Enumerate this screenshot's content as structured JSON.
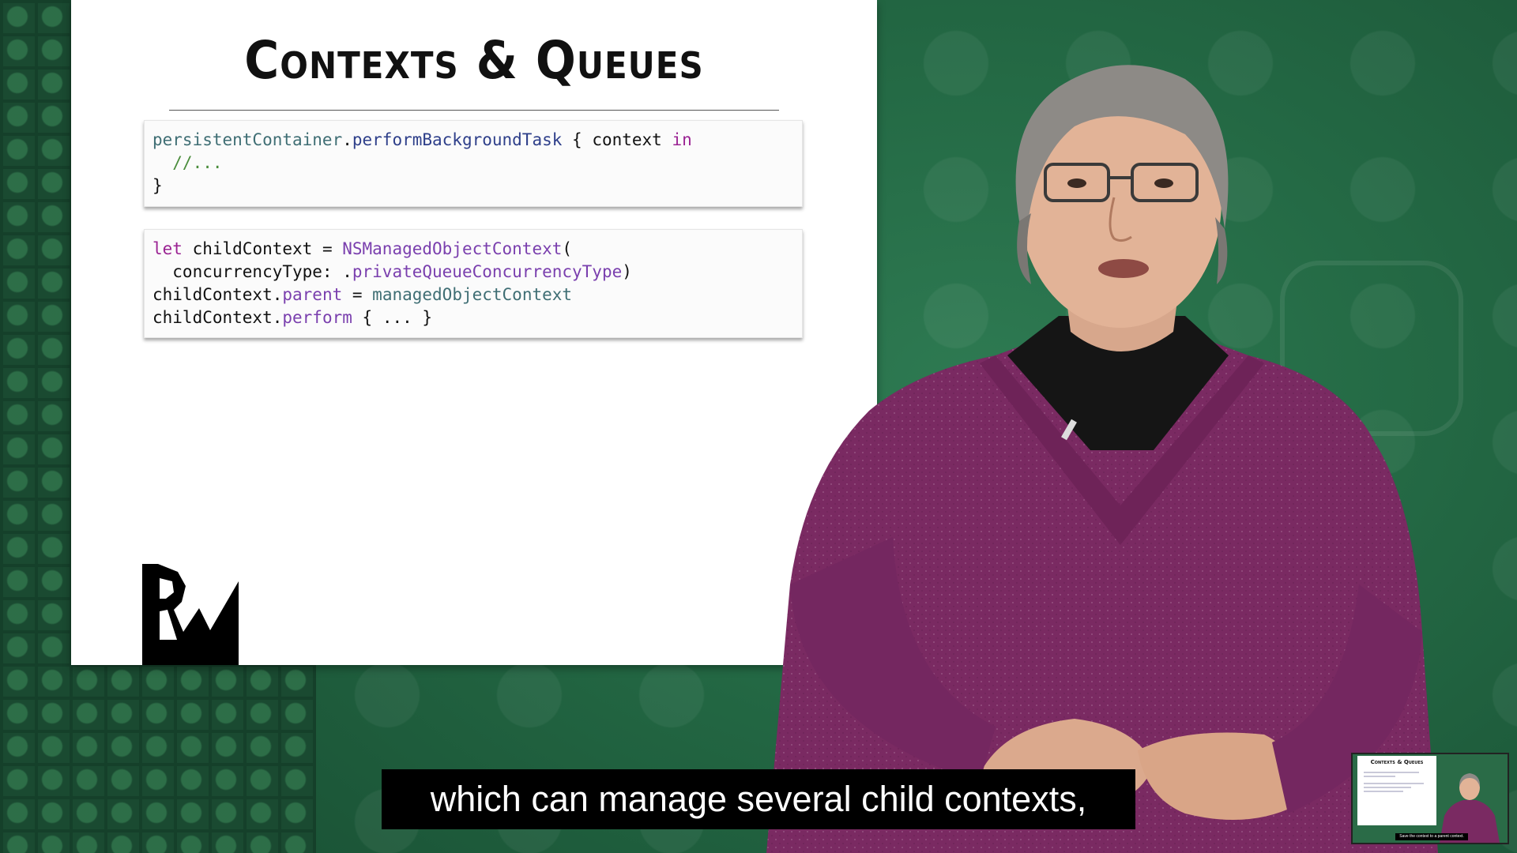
{
  "slide": {
    "title": "Contexts & Queues",
    "code_block_1": [
      [
        [
          "persistentContainer",
          "prop"
        ],
        [
          ".",
          "plain"
        ],
        [
          "performBackgroundTask",
          "fn"
        ],
        [
          " { context ",
          "plain"
        ],
        [
          "in",
          "kw"
        ]
      ],
      [
        [
          "  //...",
          "comment"
        ]
      ],
      [
        [
          "}",
          "plain"
        ]
      ]
    ],
    "code_block_2": [
      [
        [
          "let",
          "kw"
        ],
        [
          " childContext = ",
          "plain"
        ],
        [
          "NSManagedObjectContext",
          "cls"
        ],
        [
          "(",
          "plain"
        ]
      ],
      [
        [
          "  concurrencyType: .",
          "plain"
        ],
        [
          "privateQueueConcurrencyType",
          "cls"
        ],
        [
          ")",
          "plain"
        ]
      ],
      [
        [
          "childContext.",
          "plain"
        ],
        [
          "parent",
          "cls"
        ],
        [
          " = ",
          "plain"
        ],
        [
          "managedObjectContext",
          "prop"
        ]
      ],
      [
        [
          "childContext.",
          "plain"
        ],
        [
          "perform",
          "cls"
        ],
        [
          " { ... }",
          "plain"
        ]
      ]
    ]
  },
  "caption": {
    "text": "which can manage several child contexts,"
  },
  "mini_player": {
    "slide_title": "Contexts & Queues",
    "caption": "Save the context to a parent context."
  },
  "icons": {
    "logo": "raywenderlich-logo",
    "background_watermark": "swift-logo-icon"
  },
  "colors": {
    "background_green": "#246a45",
    "slide_background": "#ffffff",
    "keyword": "#9b2393",
    "class": "#7a3fae",
    "property": "#3f6e74",
    "function": "#2e3f8a",
    "comment": "#4a8d3c"
  }
}
